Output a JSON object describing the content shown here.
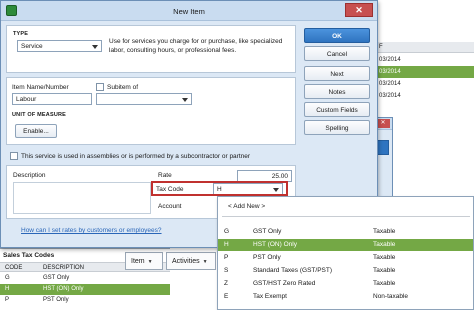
{
  "dialog": {
    "title": "New Item",
    "type_label": "TYPE",
    "type_value": "Service",
    "type_description": "Use for services you charge for or purchase, like specialized labor, consulting hours, or professional fees.",
    "item_name_label": "Item Name/Number",
    "item_name_value": "Labour",
    "subitem_label": "Subitem of",
    "unit_measure_label": "UNIT OF MEASURE",
    "enable_label": "Enable...",
    "assembly_label": "This service is used in assemblies or is performed by a subcontractor or partner",
    "description_label": "Description",
    "rate_label": "Rate",
    "rate_value": "25.00",
    "tax_code_label": "Tax Code",
    "tax_code_value": "H",
    "account_label": "Account",
    "help_link": "How can I set rates by customers or employees?"
  },
  "side_buttons": {
    "ok": "OK",
    "cancel": "Cancel",
    "next": "Next",
    "notes": "Notes",
    "custom_fields": "Custom Fields",
    "spelling": "Spelling"
  },
  "background": {
    "right_header": "F",
    "right_rows": [
      "03/2014",
      "03/2014",
      "03/2014",
      "03/2014"
    ],
    "search_label": "arch",
    "bottom_buttons": [
      "Item",
      "Activities"
    ]
  },
  "sales_tax": {
    "title": "Sales Tax Codes",
    "columns": [
      "CODE",
      "DESCRIPTION"
    ],
    "rows": [
      {
        "code": "G",
        "desc": "GST Only"
      },
      {
        "code": "H",
        "desc": "HST (ON) Only"
      },
      {
        "code": "P",
        "desc": "PST Only"
      }
    ]
  },
  "tax_dropdown": {
    "add_new": "< Add New >",
    "rows": [
      {
        "code": "G",
        "desc": "GST Only",
        "status": "Taxable"
      },
      {
        "code": "H",
        "desc": "HST (ON) Only",
        "status": "Taxable"
      },
      {
        "code": "P",
        "desc": "PST Only",
        "status": "Taxable"
      },
      {
        "code": "S",
        "desc": "Standard Taxes (GST/PST)",
        "status": "Taxable"
      },
      {
        "code": "Z",
        "desc": "GST/HST Zero Rated",
        "status": "Taxable"
      },
      {
        "code": "E",
        "desc": "Tax Exempt",
        "status": "Non-taxable"
      }
    ]
  },
  "colors": {
    "selection": "#74a845",
    "primary_button": "#2f74c0",
    "highlight_box": "#c0312f",
    "dialog_bg": "#dce8f5"
  }
}
